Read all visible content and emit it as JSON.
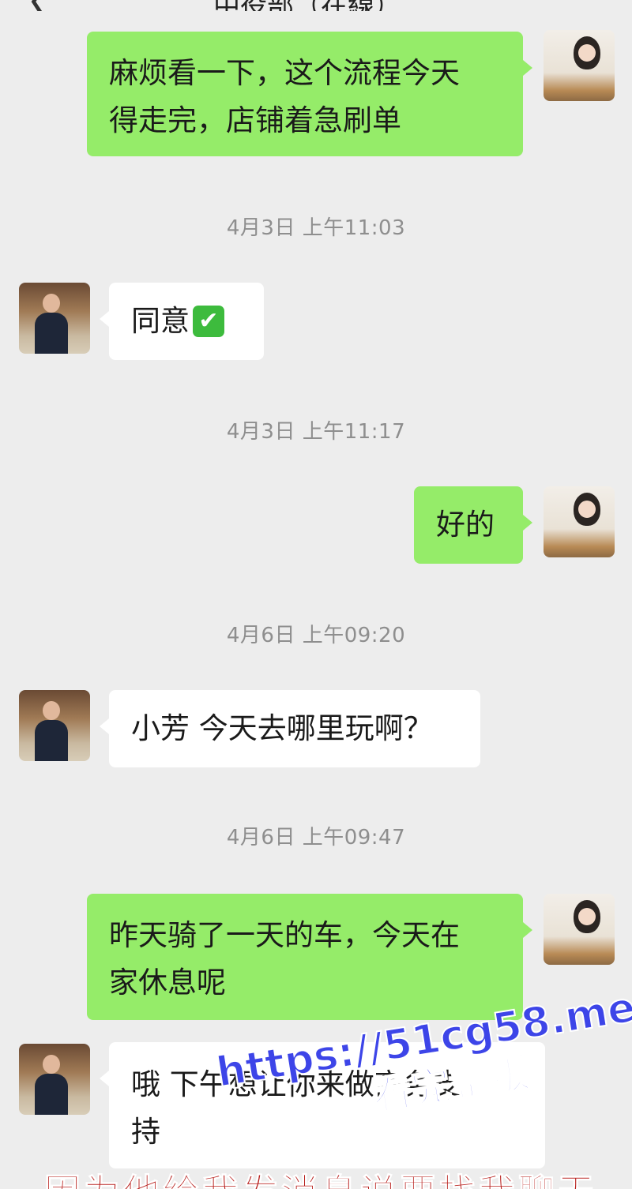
{
  "header": {
    "back_icon": "chevron-left-icon",
    "title": "中役部（在線）"
  },
  "messages": [
    {
      "side": "me",
      "text_lines": [
        "麻烦看一下，这个流程今天",
        "得走完，店铺着急刷单"
      ]
    },
    {
      "type": "time",
      "text": "4月3日 上午11:03"
    },
    {
      "side": "them",
      "text": "同意",
      "emoji": "✔"
    },
    {
      "type": "time",
      "text": "4月3日 上午11:17"
    },
    {
      "side": "me",
      "text": "好的"
    },
    {
      "type": "time",
      "text": "4月6日 上午09:20"
    },
    {
      "side": "them",
      "text": "小芳 今天去哪里玩啊？"
    },
    {
      "type": "time",
      "text": "4月6日 上午09:47"
    },
    {
      "side": "me",
      "text_lines": [
        "昨天骑了一天的车，今天在",
        "家休息呢"
      ]
    },
    {
      "side": "them",
      "text_lines": [
        "哦 下午想让你来做商务支",
        "持"
      ]
    }
  ],
  "colors": {
    "my_bubble": "#95ec69",
    "their_bubble": "#ffffff",
    "background": "#ededed"
  },
  "watermark": {
    "line1": "https://51cg58.me",
    "line2": "看完整版"
  },
  "caption": "因为他给我发消息说要找我聊天"
}
